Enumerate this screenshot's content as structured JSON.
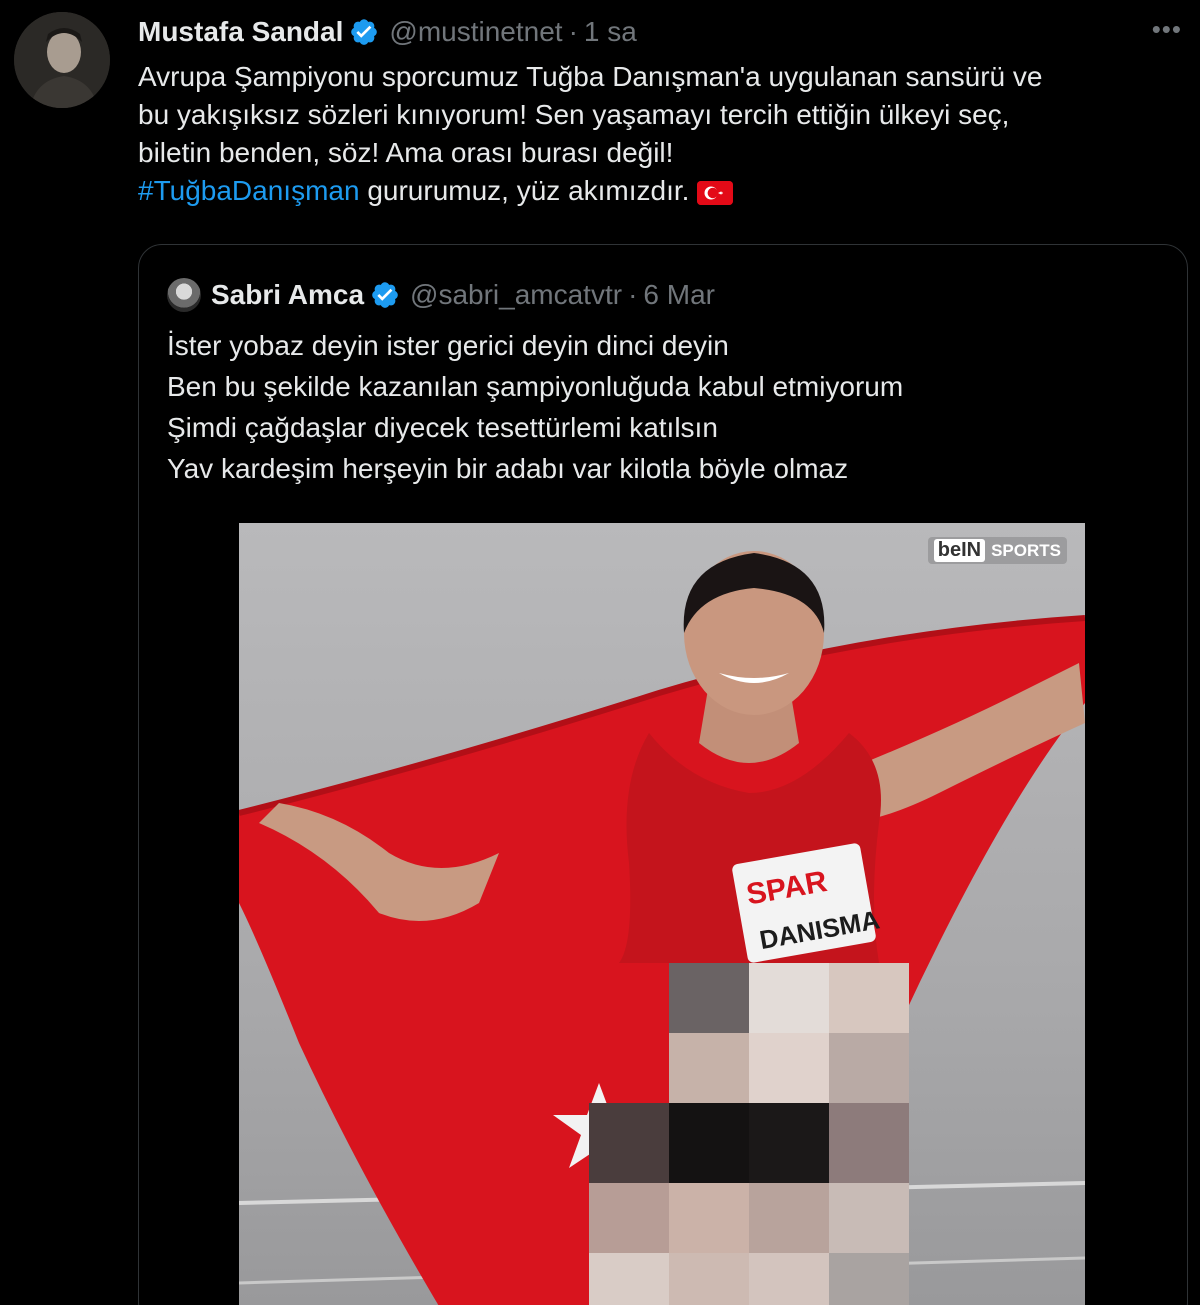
{
  "tweet": {
    "author_name": "Mustafa Sandal",
    "author_handle": "@mustinetnet",
    "separator": "·",
    "time": "1 sa",
    "more": "•••",
    "lines": [
      "Avrupa Şampiyonu sporcumuz Tuğba Danışman'a uygulanan sansürü ve",
      "bu yakışıksız sözleri kınıyorum! Sen yaşamayı tercih ettiğin ülkeyi seç,",
      "biletin benden, söz! Ama orası burası değil!"
    ],
    "hashtag": "#TuğbaDanışman",
    "last_line_rest": " gururumuz, yüz akımızdır.",
    "flag_icon": "turkey-flag-icon"
  },
  "quote": {
    "author_name": "Sabri Amca",
    "author_handle": "@sabri_amcatvtr",
    "separator": "·",
    "time": "6 Mar",
    "lines": [
      "İster yobaz deyin ister gerici deyin dinci deyin",
      "Ben bu şekilde kazanılan şampiyonluğuda kabul etmiyorum",
      "Şimdi çağdaşlar diyecek tesettürlemi katılsın",
      "Yav kardeşim herşeyin bir adabı var kilotla böyle olmaz"
    ],
    "media": {
      "watermark_brand": "beIN",
      "watermark_label": "SPORTS",
      "bib_sponsor": "SPAR",
      "bib_name": "DANISMA"
    }
  },
  "colors": {
    "background": "#000000",
    "text": "#e7e9ea",
    "muted": "#71767b",
    "link": "#1d9bf0",
    "verified": "#1d9bf0",
    "flag_red": "#e30a17",
    "border": "#2f3336"
  }
}
